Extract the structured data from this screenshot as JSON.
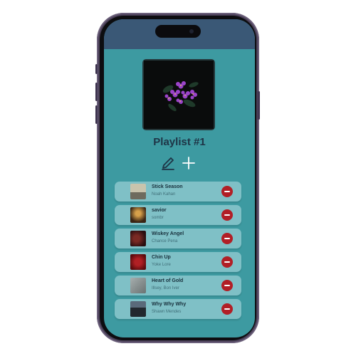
{
  "playlist": {
    "title": "Playlist #1",
    "cover_icon": "violet-flowers-image",
    "edit_icon": "pencil-icon",
    "add_icon": "plus-icon"
  },
  "songs": [
    {
      "title": "Stick Season",
      "artist": "Noah Kahan",
      "thumb_color": "#b7b39c",
      "remove_icon": "minus-circle-icon"
    },
    {
      "title": "savior",
      "artist": "sombr",
      "thumb_color": "#6a4a2a",
      "remove_icon": "minus-circle-icon"
    },
    {
      "title": "Wiskey Angel",
      "artist": "Chance Pena",
      "thumb_color": "#4a1e20",
      "remove_icon": "minus-circle-icon"
    },
    {
      "title": "Chin Up",
      "artist": "Yoke Lore",
      "thumb_color": "#7a1416",
      "remove_icon": "minus-circle-icon"
    },
    {
      "title": "Heart of Gold",
      "artist": "Illsey, Bon Iver",
      "thumb_color": "#8a9494",
      "remove_icon": "minus-circle-icon"
    },
    {
      "title": "Why Why Why",
      "artist": "Shawn Mendes",
      "thumb_color": "#3a4656",
      "remove_icon": "minus-circle-icon"
    }
  ],
  "colors": {
    "screen_bg": "#3d9aa1",
    "status_bar": "#3a5876",
    "row_bg": "#7fc0c6",
    "remove_button": "#b11f26",
    "title_text": "#1e3446"
  }
}
